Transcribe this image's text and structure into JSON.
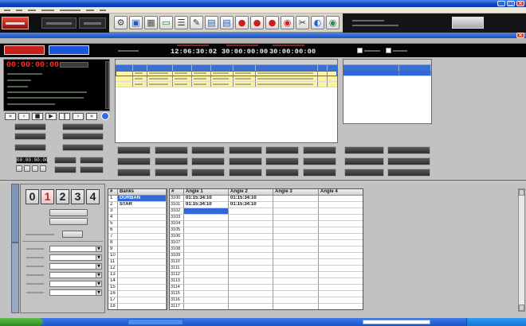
{
  "colors": {
    "title_bar": "#0d45c2",
    "selection": "#3167d6",
    "clip_row": "#fbf3a0",
    "timecode_red": "#ff2a2a",
    "active_digit": "#d42020",
    "program_1": "#c81e1e",
    "program_2": "#1c55d8",
    "record_blue": "#2f6ee0"
  },
  "window_controls": {
    "icons": [
      "minimize-icon",
      "maximize-icon",
      "close-icon"
    ]
  },
  "toolbar": {
    "icons": [
      "settings-icon",
      "camera-icon",
      "grid-icon",
      "monitor-icon",
      "list-icon",
      "pen-icon",
      "screen-icon",
      "screen-icon",
      "record-icon",
      "record-icon",
      "record-icon",
      "target-icon",
      "cut-icon",
      "tape-icon",
      "disc-icon"
    ]
  },
  "control_strip": {
    "timecodes": [
      "12:06:30:02",
      "30:00:00:00",
      "30:00:00:00"
    ]
  },
  "left_panel": {
    "main_timecode": "00:00:00:00",
    "small_timecode": "00:00:00:00"
  },
  "transport": {
    "icons": [
      "rewind-icon",
      "step-back-icon",
      "stop-icon",
      "play-icon",
      "pause-icon",
      "step-forward-icon",
      "fast-forward-icon"
    ],
    "status_icon": "status-dot-icon"
  },
  "bank_selector": {
    "digits": [
      "0",
      "1",
      "2",
      "3",
      "4"
    ],
    "active_index": 1
  },
  "banks_table": {
    "headers": [
      "#",
      "Banks"
    ],
    "selected_row": 0,
    "rows": [
      {
        "num": "1",
        "name": "DURBAN"
      },
      {
        "num": "2",
        "name": "STAR"
      },
      {
        "num": "3"
      },
      {
        "num": "4"
      },
      {
        "num": "5"
      },
      {
        "num": "6"
      },
      {
        "num": "7"
      },
      {
        "num": "8"
      },
      {
        "num": "9"
      },
      {
        "num": "10"
      },
      {
        "num": "11"
      },
      {
        "num": "12"
      },
      {
        "num": "13"
      },
      {
        "num": "14"
      },
      {
        "num": "15"
      },
      {
        "num": "16"
      },
      {
        "num": "17"
      },
      {
        "num": "18"
      }
    ]
  },
  "angles_table": {
    "headers": [
      "#",
      "Angle 1",
      "Angle 2",
      "Angle 3",
      "Angle 4"
    ],
    "selected_cell": {
      "row": 2,
      "column": 1
    },
    "rows": [
      {
        "num": "3100",
        "a1": "01:15:34:10",
        "a2": "01:15:34:10"
      },
      {
        "num": "3101",
        "a1": "01:15:34:10",
        "a2": "01:15:34:10"
      },
      {
        "num": "3102"
      },
      {
        "num": "3103"
      },
      {
        "num": "3104"
      },
      {
        "num": "3105"
      },
      {
        "num": "3106"
      },
      {
        "num": "3107"
      },
      {
        "num": "3108"
      },
      {
        "num": "3109"
      },
      {
        "num": "3110"
      },
      {
        "num": "3111"
      },
      {
        "num": "3112"
      },
      {
        "num": "3113"
      },
      {
        "num": "3114"
      },
      {
        "num": "3115"
      },
      {
        "num": "3116"
      },
      {
        "num": "3117"
      }
    ]
  }
}
